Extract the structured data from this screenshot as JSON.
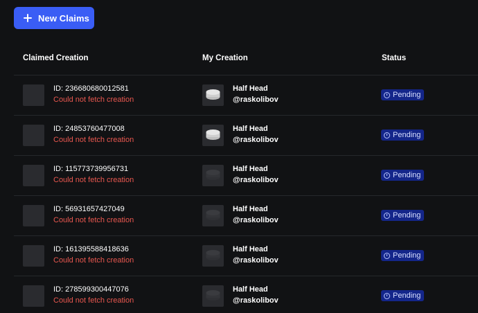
{
  "toolbar": {
    "new_claims_label": "New Claims",
    "new_claims_icon": "plus-icon",
    "accent_color": "#3a5df5"
  },
  "table": {
    "headers": [
      "Claimed Creation",
      "My Creation",
      "Status"
    ],
    "rows": [
      {
        "claim_id": "ID: 236680680012581",
        "claim_error": "Could not fetch creation",
        "creation_name": "Half Head",
        "creation_owner": "@raskolibov",
        "status": "Pending",
        "thumb_style": "light"
      },
      {
        "claim_id": "ID: 24853760477008",
        "claim_error": "Could not fetch creation",
        "creation_name": "Half Head",
        "creation_owner": "@raskolibov",
        "status": "Pending",
        "thumb_style": "light"
      },
      {
        "claim_id": "ID: 115773739956731",
        "claim_error": "Could not fetch creation",
        "creation_name": "Half Head",
        "creation_owner": "@raskolibov",
        "status": "Pending",
        "thumb_style": "dark"
      },
      {
        "claim_id": "ID: 56931657427049",
        "claim_error": "Could not fetch creation",
        "creation_name": "Half Head",
        "creation_owner": "@raskolibov",
        "status": "Pending",
        "thumb_style": "dark"
      },
      {
        "claim_id": "ID: 161395588418636",
        "claim_error": "Could not fetch creation",
        "creation_name": "Half Head",
        "creation_owner": "@raskolibov",
        "status": "Pending",
        "thumb_style": "dark"
      },
      {
        "claim_id": "ID: 278599300447076",
        "claim_error": "Could not fetch creation",
        "creation_name": "Half Head",
        "creation_owner": "@raskolibov",
        "status": "Pending",
        "thumb_style": "dark"
      }
    ]
  },
  "colors": {
    "error_text": "#e8574f",
    "status_badge_bg": "#14268a",
    "background": "#111214"
  }
}
